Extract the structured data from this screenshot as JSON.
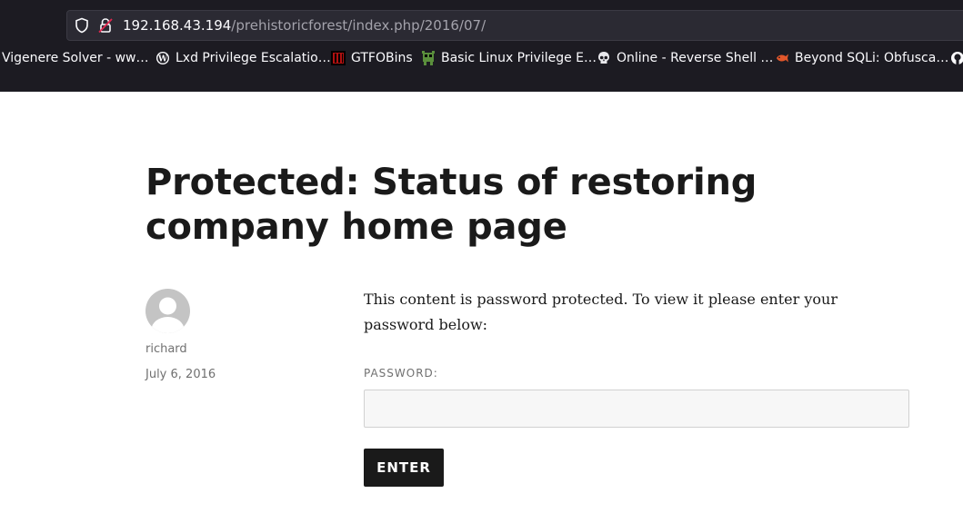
{
  "browser": {
    "url_host": "192.168.43.194",
    "url_path": "/prehistoricforest/index.php/2016/07/",
    "bookmarks": [
      {
        "label": "Vigenere Solver - ww…",
        "icon": "none"
      },
      {
        "label": "Lxd Privilege Escalatio…",
        "icon": "wordpress-icon"
      },
      {
        "label": "GTFOBins",
        "icon": "gtfobins-icon"
      },
      {
        "label": "Basic Linux Privilege E…",
        "icon": "pixel-creature-icon"
      },
      {
        "label": "Online - Reverse Shell …",
        "icon": "skull-icon"
      },
      {
        "label": "Beyond SQLi: Obfusca…",
        "icon": "fish-icon"
      }
    ]
  },
  "post": {
    "title": "Protected: Status of restoring company home page",
    "author": "richard",
    "date": "July 6, 2016",
    "protected_message": "This content is password protected. To view it please enter your password below:",
    "password_label": "PASSWORD:",
    "password_value": "",
    "submit_label": "ENTER"
  },
  "colors": {
    "chrome_bg": "#1c1b22",
    "urlbar_bg": "#2b2a33",
    "text_dark": "#1a1a1a",
    "text_muted": "#707070",
    "input_bg": "#f7f7f7",
    "button_bg": "#1a1a1a"
  }
}
